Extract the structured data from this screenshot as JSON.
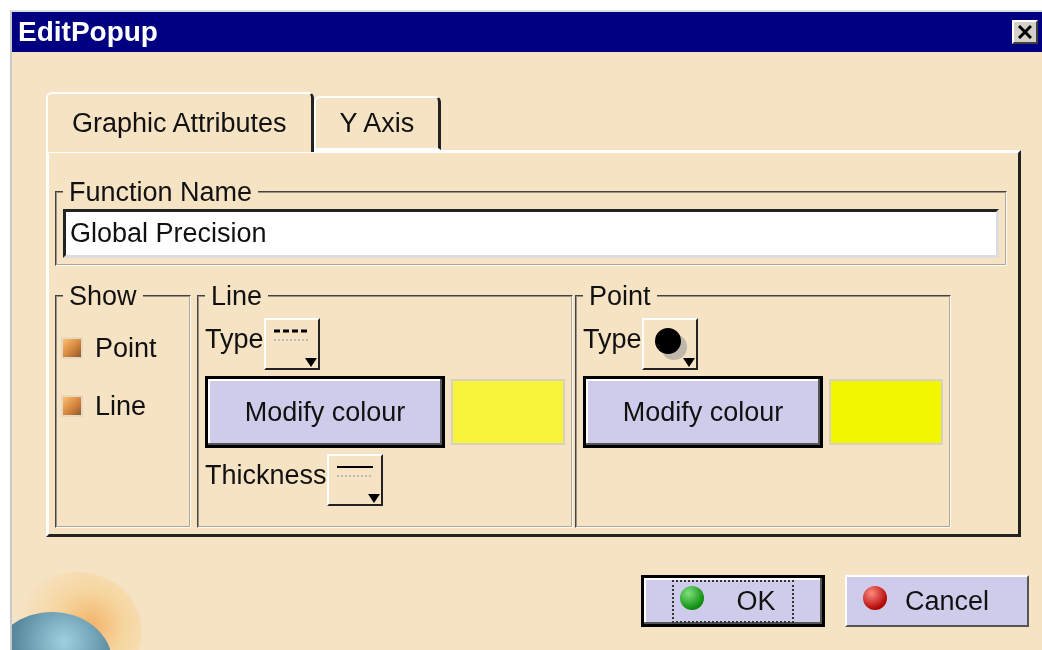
{
  "window": {
    "title": "EditPopup"
  },
  "tabs": [
    {
      "label": "Graphic Attributes",
      "selected": true
    },
    {
      "label": "Y Axis",
      "selected": false
    }
  ],
  "function_name": {
    "label": "Function Name",
    "value": "Global Precision"
  },
  "show": {
    "label": "Show",
    "items": [
      {
        "label": "Point",
        "checked": true
      },
      {
        "label": "Line",
        "checked": true
      }
    ]
  },
  "line": {
    "label": "Line",
    "type_label": "Type",
    "button": "Modify colour",
    "color": "#f8f43a",
    "thickness_label": "Thickness"
  },
  "point": {
    "label": "Point",
    "type_label": "Type",
    "button": "Modify colour",
    "color": "#f2f700"
  },
  "buttons": [
    {
      "label": "OK",
      "kind": "ok",
      "default": true
    },
    {
      "label": "Cancel",
      "kind": "cancel",
      "default": false
    }
  ]
}
